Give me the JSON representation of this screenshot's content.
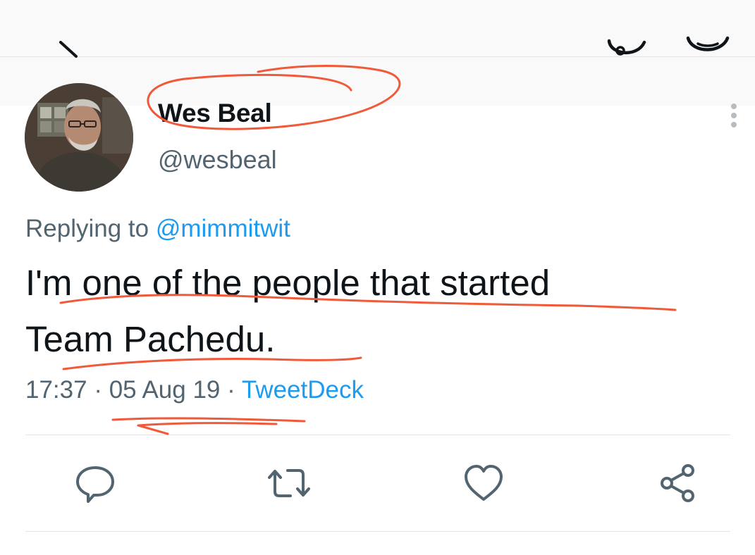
{
  "tweet": {
    "author": {
      "display_name": "Wes Beal",
      "handle": "@wesbeal"
    },
    "reply_context": {
      "prefix": "Replying to",
      "mention": "@mimmitwit"
    },
    "text_line1": "I'm one of the people that started",
    "text_line2": "Team Pachedu.",
    "time": "17:37",
    "date": "05 Aug 19",
    "source": "TweetDeck",
    "separator": "·"
  },
  "icons": {
    "back": "back-arrow-icon",
    "top_right_1": "at-icon",
    "top_right_2": "emoji-icon",
    "more": "more-vertical-icon",
    "reply": "reply-icon",
    "retweet": "retweet-icon",
    "like": "heart-icon",
    "share": "share-icon",
    "annotation": "red-ink-underline"
  },
  "colors": {
    "text": "#0f1419",
    "secondary": "#536471",
    "link": "#1d9bf0",
    "annotation": "#f05a3a"
  }
}
